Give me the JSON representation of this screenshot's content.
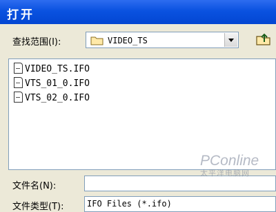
{
  "window": {
    "title": "打开"
  },
  "look_in": {
    "label": "查找范围(I):",
    "value": "VIDEO_TS"
  },
  "files": [
    {
      "name": "VIDEO_TS.IFO"
    },
    {
      "name": "VTS_01_0.IFO"
    },
    {
      "name": "VTS_02_0.IFO"
    }
  ],
  "file_name": {
    "label": "文件名(N):",
    "value": ""
  },
  "file_type": {
    "label": "文件类型(T):",
    "value": "IFO Files (*.ifo)"
  },
  "watermark": {
    "brand": "PConline",
    "sub": "太平洋电脑网"
  },
  "colors": {
    "titlebar": "#0a52e0",
    "dialog_bg": "#ece9d8",
    "field_border": "#7f9db9"
  },
  "icons": {
    "folder": "folder-icon",
    "up_folder": "up-folder-icon",
    "file": "file-icon"
  }
}
